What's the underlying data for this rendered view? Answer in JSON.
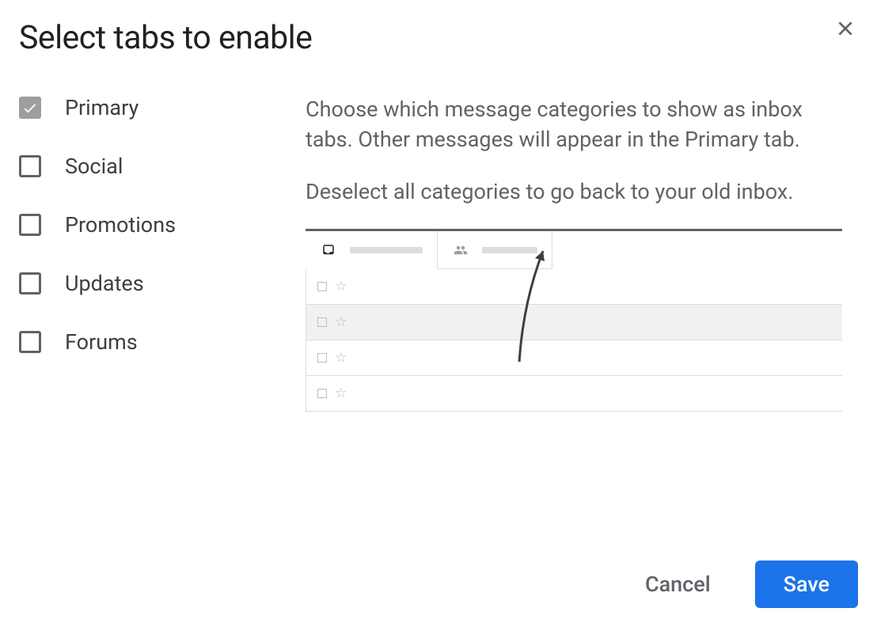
{
  "dialog": {
    "title": "Select tabs to enable",
    "categories": [
      {
        "label": "Primary",
        "checked": true,
        "disabled": true
      },
      {
        "label": "Social",
        "checked": false,
        "disabled": false
      },
      {
        "label": "Promotions",
        "checked": false,
        "disabled": false
      },
      {
        "label": "Updates",
        "checked": false,
        "disabled": false
      },
      {
        "label": "Forums",
        "checked": false,
        "disabled": false
      }
    ],
    "description": {
      "para1": "Choose which message categories to show as inbox tabs. Other messages will appear in the Primary tab.",
      "para2": "Deselect all categories to go back to your old inbox."
    },
    "buttons": {
      "cancel": "Cancel",
      "save": "Save"
    }
  }
}
